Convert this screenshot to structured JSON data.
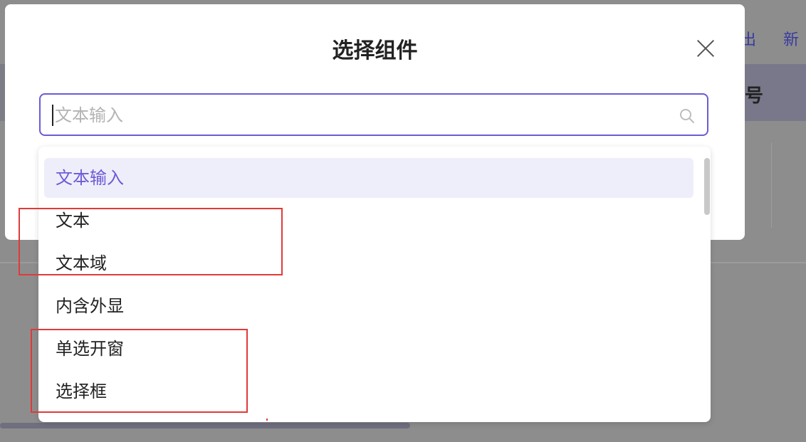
{
  "background": {
    "links": [
      "出",
      "新"
    ],
    "column_title": "号"
  },
  "modal": {
    "title": "选择组件",
    "search": {
      "value": "",
      "placeholder": "文本输入"
    }
  },
  "dropdown": {
    "items": [
      {
        "label": "文本输入",
        "active": true
      },
      {
        "label": "文本",
        "active": false
      },
      {
        "label": "文本域",
        "active": false
      },
      {
        "label": "内含外显",
        "active": false
      },
      {
        "label": "单选开窗",
        "active": false
      },
      {
        "label": "选择框",
        "active": false
      }
    ]
  },
  "colors": {
    "accent": "#6b5bd6",
    "annotation": "#e03a3a",
    "active_bg": "#eeeefb"
  }
}
